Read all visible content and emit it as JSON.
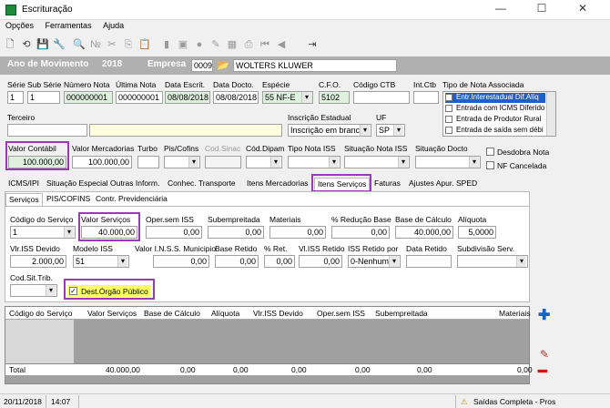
{
  "window": {
    "title": "Escrituração",
    "min": "—",
    "max": "☐",
    "close": "✕"
  },
  "menu": [
    "Opções",
    "Ferramentas",
    "Ajuda"
  ],
  "header": {
    "ano_label": "Ano de Movimento",
    "ano_value": "2018",
    "empresa_label": "Empresa",
    "empresa_code": "0009",
    "empresa_name": "WOLTERS KLUWER"
  },
  "fields": {
    "serie_label": "Série",
    "serie": "1",
    "subserie_label": "Sub Série",
    "subserie": "1",
    "numero_label": "Número Nota",
    "numero": "000000001",
    "ultima_label": "Última Nota",
    "ultima": "000000001",
    "data_escrit_label": "Data Escrit.",
    "data_escrit": "08/08/2018",
    "data_docto_label": "Data Docto.",
    "data_docto": "08/08/2018",
    "especie_label": "Espécie",
    "especie": "55  NF-E",
    "cfo_label": "C.F.O.",
    "cfo": "5102",
    "codctb_label": "Código CTB",
    "intctb_label": "Int.Ctb",
    "tipo_nota_label": "Tipo de Nota Associada",
    "terceiro_label": "Terceiro",
    "insc_label": "Inscrição Estadual",
    "insc": "Inscrição em branco",
    "uf_label": "UF",
    "uf": "SP",
    "valor_contabil_label": "Valor Contábil",
    "valor_contabil": "100.000,00",
    "valor_merc_label": "Valor Mercadorias",
    "valor_merc": "100.000,00",
    "turbo_label": "Turbo",
    "piscofins_label": "Pis/Cofins",
    "codsinac_label": "Cod.Sinac",
    "coddipam_label": "Cód.Dipam",
    "tiponotaiss_label": "Tipo Nota ISS",
    "situacaoiss_label": "Situação Nota ISS",
    "situacaodocto_label": "Situação Docto",
    "desdobra_label": "Desdobra Nota",
    "nfcancelada_label": "NF Cancelada"
  },
  "tipo_nota_items": [
    "Entr.Interestadual Dif.Alíq",
    "Entrada com ICMS Diferido",
    "Entrada de Produtor Rural",
    "Entrada de saída sem débi"
  ],
  "tabs1": [
    "ICMS/IPI",
    "Situação Especial",
    "Outras Inform.",
    "Conhec. Transporte",
    "Itens Mercadorias",
    "Itens Serviços",
    "Faturas",
    "Ajustes Apur. SPED"
  ],
  "tabs2": [
    "Serviços",
    "PIS/COFINS",
    "Contr. Previdenciária"
  ],
  "servico": {
    "codigo_label": "Código do Serviço",
    "codigo": "1",
    "valor_label": "Valor Serviços",
    "valor": "40.000,00",
    "operiss_label": "Oper.sem ISS",
    "operiss": "0,00",
    "subemp_label": "Subempreitada",
    "subemp": "0,00",
    "materiais_label": "Materiais",
    "materiais": "0,00",
    "reducao_label": "% Redução Base",
    "reducao": "0,00",
    "basecalc_label": "Base de Cálculo",
    "basecalc": "40.000,00",
    "aliquota_label": "Alíquota",
    "aliquota": "5,0000",
    "vlrissdev_label": "Vlr.ISS Devido",
    "vlrissdev": "2.000,00",
    "modeloiss_label": "Modelo ISS",
    "modeloiss": "51",
    "inss_label": "Valor I.N.S.S. Municipio",
    "inss": "0,00",
    "baseret_label": "Base Retido",
    "baseret": "0,00",
    "pret_label": "% Ret.",
    "pret": "0,00",
    "vlissret_label": "Vl.ISS Retido",
    "vlissret": "0,00",
    "issretpor_label": "ISS Retido por",
    "issretpor": "0-Nenhum",
    "dataret_label": "Data Retido",
    "subdiv_label": "Subdivisão Serv.",
    "codsit_label": "Cod.Sit.Trib.",
    "dest_label": "Dest.Órgão Público"
  },
  "grid": {
    "headers": [
      "Código do Serviço",
      "Valor Serviços",
      "Base de Cálculo",
      "Alíquota",
      "Vlr.ISS Devido",
      "Oper.sem ISS",
      "Subempreitada",
      "Materiais"
    ],
    "total_label": "Total",
    "totals": [
      "40.000,00",
      "0,00",
      "0,00",
      "0,00",
      "0,00",
      "0,00",
      "0,00"
    ]
  },
  "status": {
    "date": "20/11/2018",
    "time": "14:07",
    "msg": "Saídas Completa - Pros"
  },
  "colors": {
    "highlight": "#9b3ab5",
    "green_field": "#dff0df",
    "yellow": "#ffff66",
    "plus": "#1e5fc8",
    "minus": "#d11"
  }
}
